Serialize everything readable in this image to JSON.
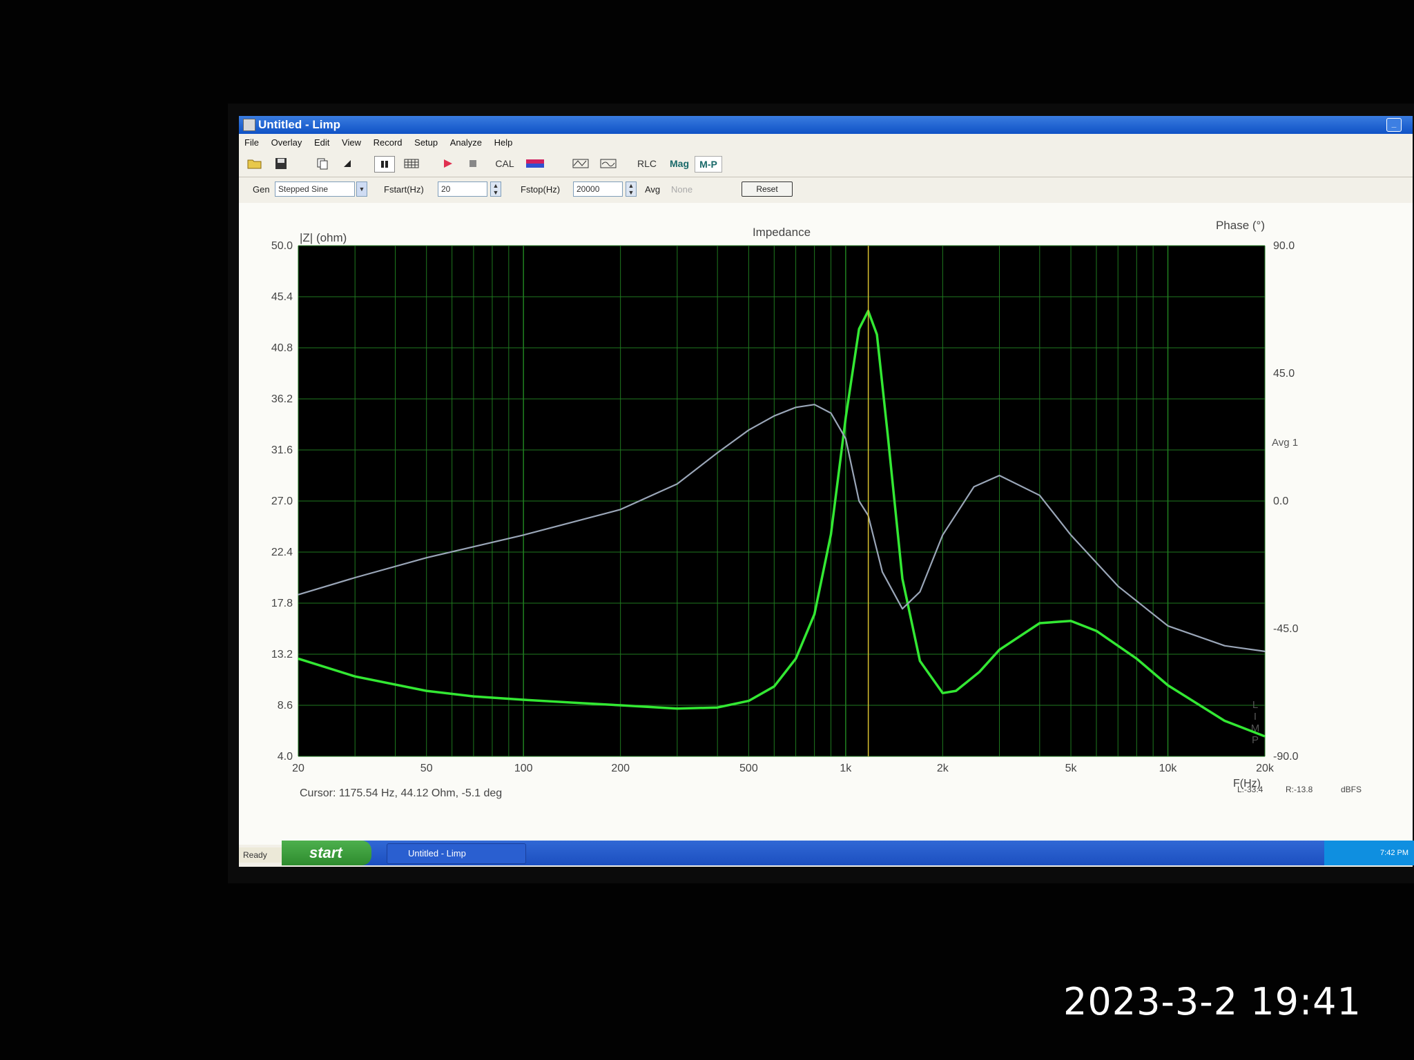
{
  "window": {
    "title": "Untitled - Limp"
  },
  "menu": [
    "File",
    "Overlay",
    "Edit",
    "View",
    "Record",
    "Setup",
    "Analyze",
    "Help"
  ],
  "toolbar": {
    "cal_label": "CAL",
    "rlc_label": "RLC",
    "mag_label": "Mag",
    "mp_label": "M-P"
  },
  "params": {
    "gen_label": "Gen",
    "gen_value": "Stepped Sine",
    "fstart_label": "Fstart(Hz)",
    "fstart_value": "20",
    "fstop_label": "Fstop(Hz)",
    "fstop_value": "20000",
    "avg_label": "Avg",
    "avg_value": "None",
    "reset_label": "Reset"
  },
  "chart_data": {
    "type": "line",
    "title": "Impedance",
    "ylabel_left": "|Z| (ohm)",
    "ylabel_right": "Phase (°)",
    "xlabel": "F(Hz)",
    "x_scale": "log",
    "xlim": [
      20,
      20000
    ],
    "ylim_left": [
      4.0,
      50.0
    ],
    "ylim_right": [
      -90,
      90
    ],
    "y_ticks_left": [
      "50.0",
      "45.4",
      "40.8",
      "36.2",
      "31.6",
      "27.0",
      "22.4",
      "17.8",
      "13.2",
      "8.6",
      "4.0"
    ],
    "y_ticks_right": [
      "90.0",
      "45.0",
      "0.0",
      "-45.0",
      "-90.0"
    ],
    "x_ticks": [
      "20",
      "50",
      "100",
      "200",
      "500",
      "1k",
      "2k",
      "5k",
      "10k",
      "20k"
    ],
    "x_tick_values": [
      20,
      50,
      100,
      200,
      500,
      1000,
      2000,
      5000,
      10000,
      20000
    ],
    "series": [
      {
        "color": "#33e833",
        "axis": "left",
        "x": [
          20,
          30,
          50,
          70,
          100,
          150,
          200,
          300,
          400,
          500,
          600,
          700,
          800,
          900,
          1000,
          1100,
          1175,
          1250,
          1350,
          1500,
          1700,
          2000,
          2200,
          2600,
          3000,
          4000,
          5000,
          6000,
          8000,
          10000,
          15000,
          20000
        ],
        "y": [
          12.8,
          11.2,
          9.9,
          9.4,
          9.1,
          8.8,
          8.6,
          8.3,
          8.4,
          9.0,
          10.3,
          12.8,
          16.8,
          24.0,
          34.5,
          42.5,
          44.12,
          42.0,
          33.0,
          20.0,
          12.6,
          9.7,
          9.9,
          11.6,
          13.6,
          16.0,
          16.2,
          15.3,
          12.8,
          10.4,
          7.2,
          5.8
        ]
      },
      {
        "color": "#9aa6b8",
        "axis": "right",
        "x": [
          20,
          30,
          50,
          100,
          200,
          300,
          400,
          500,
          600,
          700,
          800,
          900,
          1000,
          1100,
          1175,
          1300,
          1500,
          1700,
          2000,
          2500,
          3000,
          4000,
          5000,
          7000,
          10000,
          15000,
          20000
        ],
        "y": [
          -33,
          -27,
          -20,
          -12,
          -3,
          6,
          17,
          25,
          30,
          33,
          34,
          31,
          22,
          0,
          -5.1,
          -25,
          -38,
          -32,
          -12,
          5,
          9,
          2,
          -12,
          -30,
          -44,
          -51,
          -53
        ]
      }
    ],
    "cursor": {
      "x": 1175.54,
      "label": "Cursor: 1175.54 Hz, 44.12 Ohm, -5.1 deg",
      "color": "#d8c030"
    },
    "grid": true,
    "background": "#000000",
    "side_labels": {
      "avg": "Avg 1",
      "mode": "LIMP"
    },
    "readouts": [
      "L:-33.4",
      "R:-13.8",
      "dBFS"
    ]
  },
  "status": {
    "text": "Ready"
  },
  "taskbar": {
    "start_label": "start",
    "task_label": "Untitled - Limp",
    "clock": "7:42 PM"
  },
  "photo_timestamp": "2023-3-2 19:41",
  "colors": {
    "titlebar": "#0f52c6",
    "impedance": "#33e833",
    "phase": "#9aa6b8",
    "cursor": "#d8c030"
  }
}
